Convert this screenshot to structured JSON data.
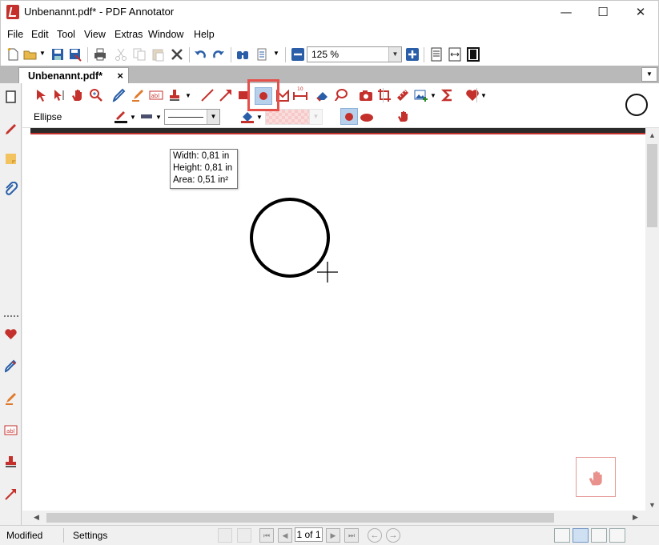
{
  "window": {
    "title": "Unbenannt.pdf* - PDF Annotator",
    "minimize": "—",
    "maximize": "☐",
    "close": "✕"
  },
  "menu": [
    "File",
    "Edit",
    "Tool",
    "View",
    "Extras",
    "Window",
    "Help"
  ],
  "zoom": {
    "value": "125 %"
  },
  "tab": {
    "label": "Unbenannt.pdf*",
    "close": "×"
  },
  "tool": {
    "name": "Ellipse"
  },
  "tooltip": {
    "width": "Width: 0,81 in",
    "height": "Height:  0,81 in",
    "area": "Area: 0,51 in²"
  },
  "status": {
    "modified": "Modified",
    "settings": "Settings",
    "page": "1 of 1"
  },
  "colors": {
    "accent_red": "#c4302b",
    "highlight_box": "#e4504b",
    "line_color": "#111111",
    "fill_color": "#4a4f6e"
  }
}
